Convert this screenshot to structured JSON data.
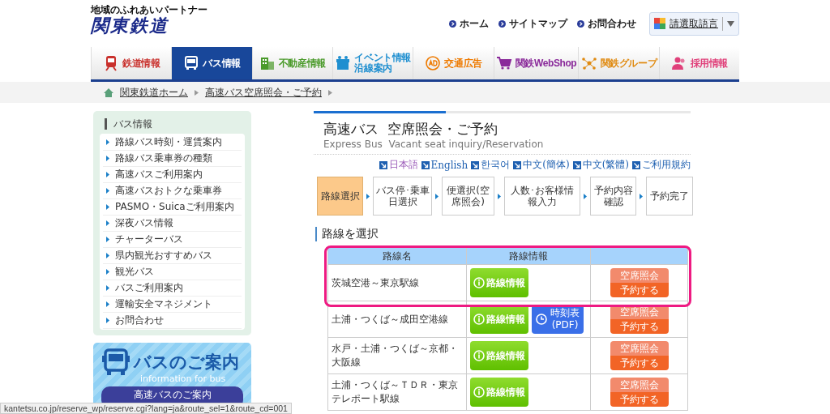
{
  "header": {
    "tagline": "地域のふれあいパートナー",
    "logo": "関東鉄道",
    "links": [
      "ホーム",
      "サイトマップ",
      "お問合わせ"
    ],
    "translate": "請選取語言"
  },
  "nav": [
    {
      "label": "鉄道情報",
      "kind": "train",
      "color": "#c9302c",
      "selected": false
    },
    {
      "label": "バス情報",
      "kind": "bus",
      "color": "#ffffff",
      "selected": true
    },
    {
      "label": "不動産情報",
      "kind": "building",
      "color": "#4a9a2a",
      "selected": false
    },
    {
      "label": "イベント情報",
      "label_2": "沿線案内",
      "kind": "gift",
      "color": "#1f8fd0",
      "selected": false
    },
    {
      "label": "交通広告",
      "kind": "ad",
      "color": "#ee7a00",
      "selected": false
    },
    {
      "label": "関鉄WebShop",
      "kind": "cart",
      "color": "#8a2a9a",
      "selected": false
    },
    {
      "label": "関鉄グループ",
      "kind": "network",
      "color": "#e08a10",
      "selected": false
    },
    {
      "label": "採用情報",
      "kind": "people",
      "color": "#e0407a",
      "selected": false
    }
  ],
  "breadcrumb": [
    "関東鉄道ホーム",
    "高速バス空席照会・ご予約"
  ],
  "sidebar": {
    "title": "バス情報",
    "items": [
      "路線バス時刻・運賃案内",
      "路線バス乗車券の種類",
      "高速バスご利用案内",
      "高速バスおトクな乗車券",
      "PASMO・Suicaご利用案内",
      "深夜バス情報",
      "チャーターバス",
      "県内観光おすすめバス",
      "観光バス",
      "バスご利用案内",
      "運輸安全マネジメント",
      "お問合わせ"
    ]
  },
  "banner": {
    "title": "バスのご案内",
    "subtitle": "information for bus",
    "button": "高速バスのご案内"
  },
  "main": {
    "title": "高速バス  空席照会・ご予約",
    "subtitle": "Express Bus  Vacant seat inquiry/Reservation",
    "languages": [
      {
        "label": "日本語",
        "selected": true
      },
      {
        "label": "English",
        "selected": false
      },
      {
        "label": "한국어",
        "selected": false
      },
      {
        "label": "中文(簡体)",
        "selected": false
      },
      {
        "label": "中文(繁體)",
        "selected": false
      },
      {
        "label": "ご利用規約",
        "selected": false
      }
    ],
    "steps": [
      {
        "label": "路線選択",
        "selected": true
      },
      {
        "label": "バス停･乗車日選択",
        "selected": false
      },
      {
        "label": "便選択(空席照会)",
        "selected": false
      },
      {
        "label": "人数･お客様情報入力",
        "selected": false
      },
      {
        "label": "予約内容確認",
        "selected": false
      },
      {
        "label": "予約完了",
        "selected": false
      }
    ],
    "section_title": "路線を選択",
    "table": {
      "columns": [
        "路線名",
        "路線情報"
      ],
      "rows": [
        {
          "name": "茨城空港～東京駅線",
          "highlighted": true,
          "info": "路線情報",
          "reserve": [
            "空席照会",
            "予約する"
          ]
        },
        {
          "name": "土浦・つくば～成田空港線",
          "highlighted": false,
          "info": "路線情報",
          "timetable": [
            "時刻表",
            "(PDF)"
          ],
          "reserve": [
            "空席照会",
            "予約する"
          ]
        },
        {
          "name": "水戸・土浦・つくば～京都・大阪線",
          "highlighted": false,
          "info": "路線情報",
          "reserve": [
            "空席照会",
            "予約する"
          ]
        },
        {
          "name": "土浦・つくば～ＴＤＲ・東京テレポート駅線",
          "highlighted": false,
          "info": "路線情報",
          "reserve": [
            "空席照会",
            "予約する"
          ]
        }
      ]
    }
  },
  "status_bar": "kantetsu.co.jp/reserve_wp/reserve.cgi?lang=ja&route_sel=1&route_cd=001"
}
